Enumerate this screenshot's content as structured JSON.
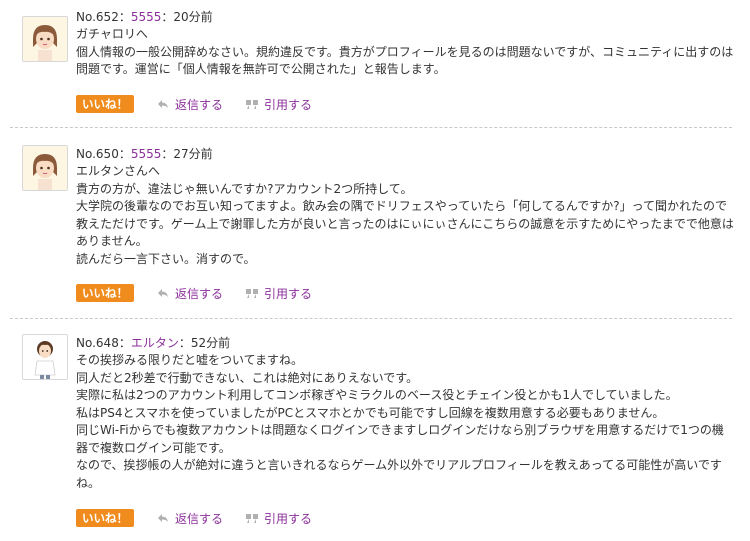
{
  "posts": [
    {
      "number": "No.652",
      "user": "5555",
      "time": "20分前",
      "avatar_icon": "avatar-girl-icon",
      "lines": [
        "ガチャロリへ",
        "個人情報の一般公開辞めなさい。規約違反です。貴方がプロフィールを見るのは問題ないですが、コミュニティに出すのは",
        "問題です。運営に「個人情報を無許可で公開された」と報告します。"
      ]
    },
    {
      "number": "No.650",
      "user": "5555",
      "time": "27分前",
      "avatar_icon": "avatar-girl-icon",
      "lines": [
        "エルタンさんへ",
        "貴方の方が、違法じゃ無いんですか?アカウント2つ所持して。",
        "大学院の後輩なのでお互い知ってますよ。飲み会の隅でドリフェスやっていたら「何してるんですか?」って聞かれたので",
        "教えただけです。ゲーム上で謝罪した方が良いと言ったのはにぃにぃさんにこちらの誠意を示すためにやったまでで他意は",
        "ありません。",
        "読んだら一言下さい。消すので。"
      ]
    },
    {
      "number": "No.648",
      "user": "エルタン",
      "time": "52分前",
      "avatar_icon": "avatar-boy-icon",
      "lines": [
        "その挨拶みる限りだと嘘をついてますね。",
        "同人だと2秒差で行動できない、これは絶対にありえないです。",
        "実際に私は2つのアカウント利用してコンボ稼ぎやミラクルのベース役とチェイン役とかも1人でしていました。",
        "私はPS4とスマホを使っていましたがPCとスマホとかでも可能ですし回線を複数用意する必要もありません。",
        "同じWi-Fiからでも複数アカウントは問題なくログインできますしログインだけなら別ブラウザを用意するだけで1つの機",
        "器で複数ログイン可能です。",
        "なので、挨拶帳の人が絶対に違うと言いきれるならゲーム外以外でリアルプロフィールを教えあってる可能性が高いです",
        "ね。"
      ]
    }
  ],
  "actions": {
    "like_label": "いいね！",
    "reply_label": "返信する",
    "quote_label": "引用する",
    "reply_icon": "reply-arrow-icon",
    "quote_icon": "quote-icon"
  },
  "colors": {
    "like_button": "#f08c1e",
    "link": "#8b2f9a",
    "icon": "#b0b0b0",
    "divider": "#c9c9c9"
  }
}
